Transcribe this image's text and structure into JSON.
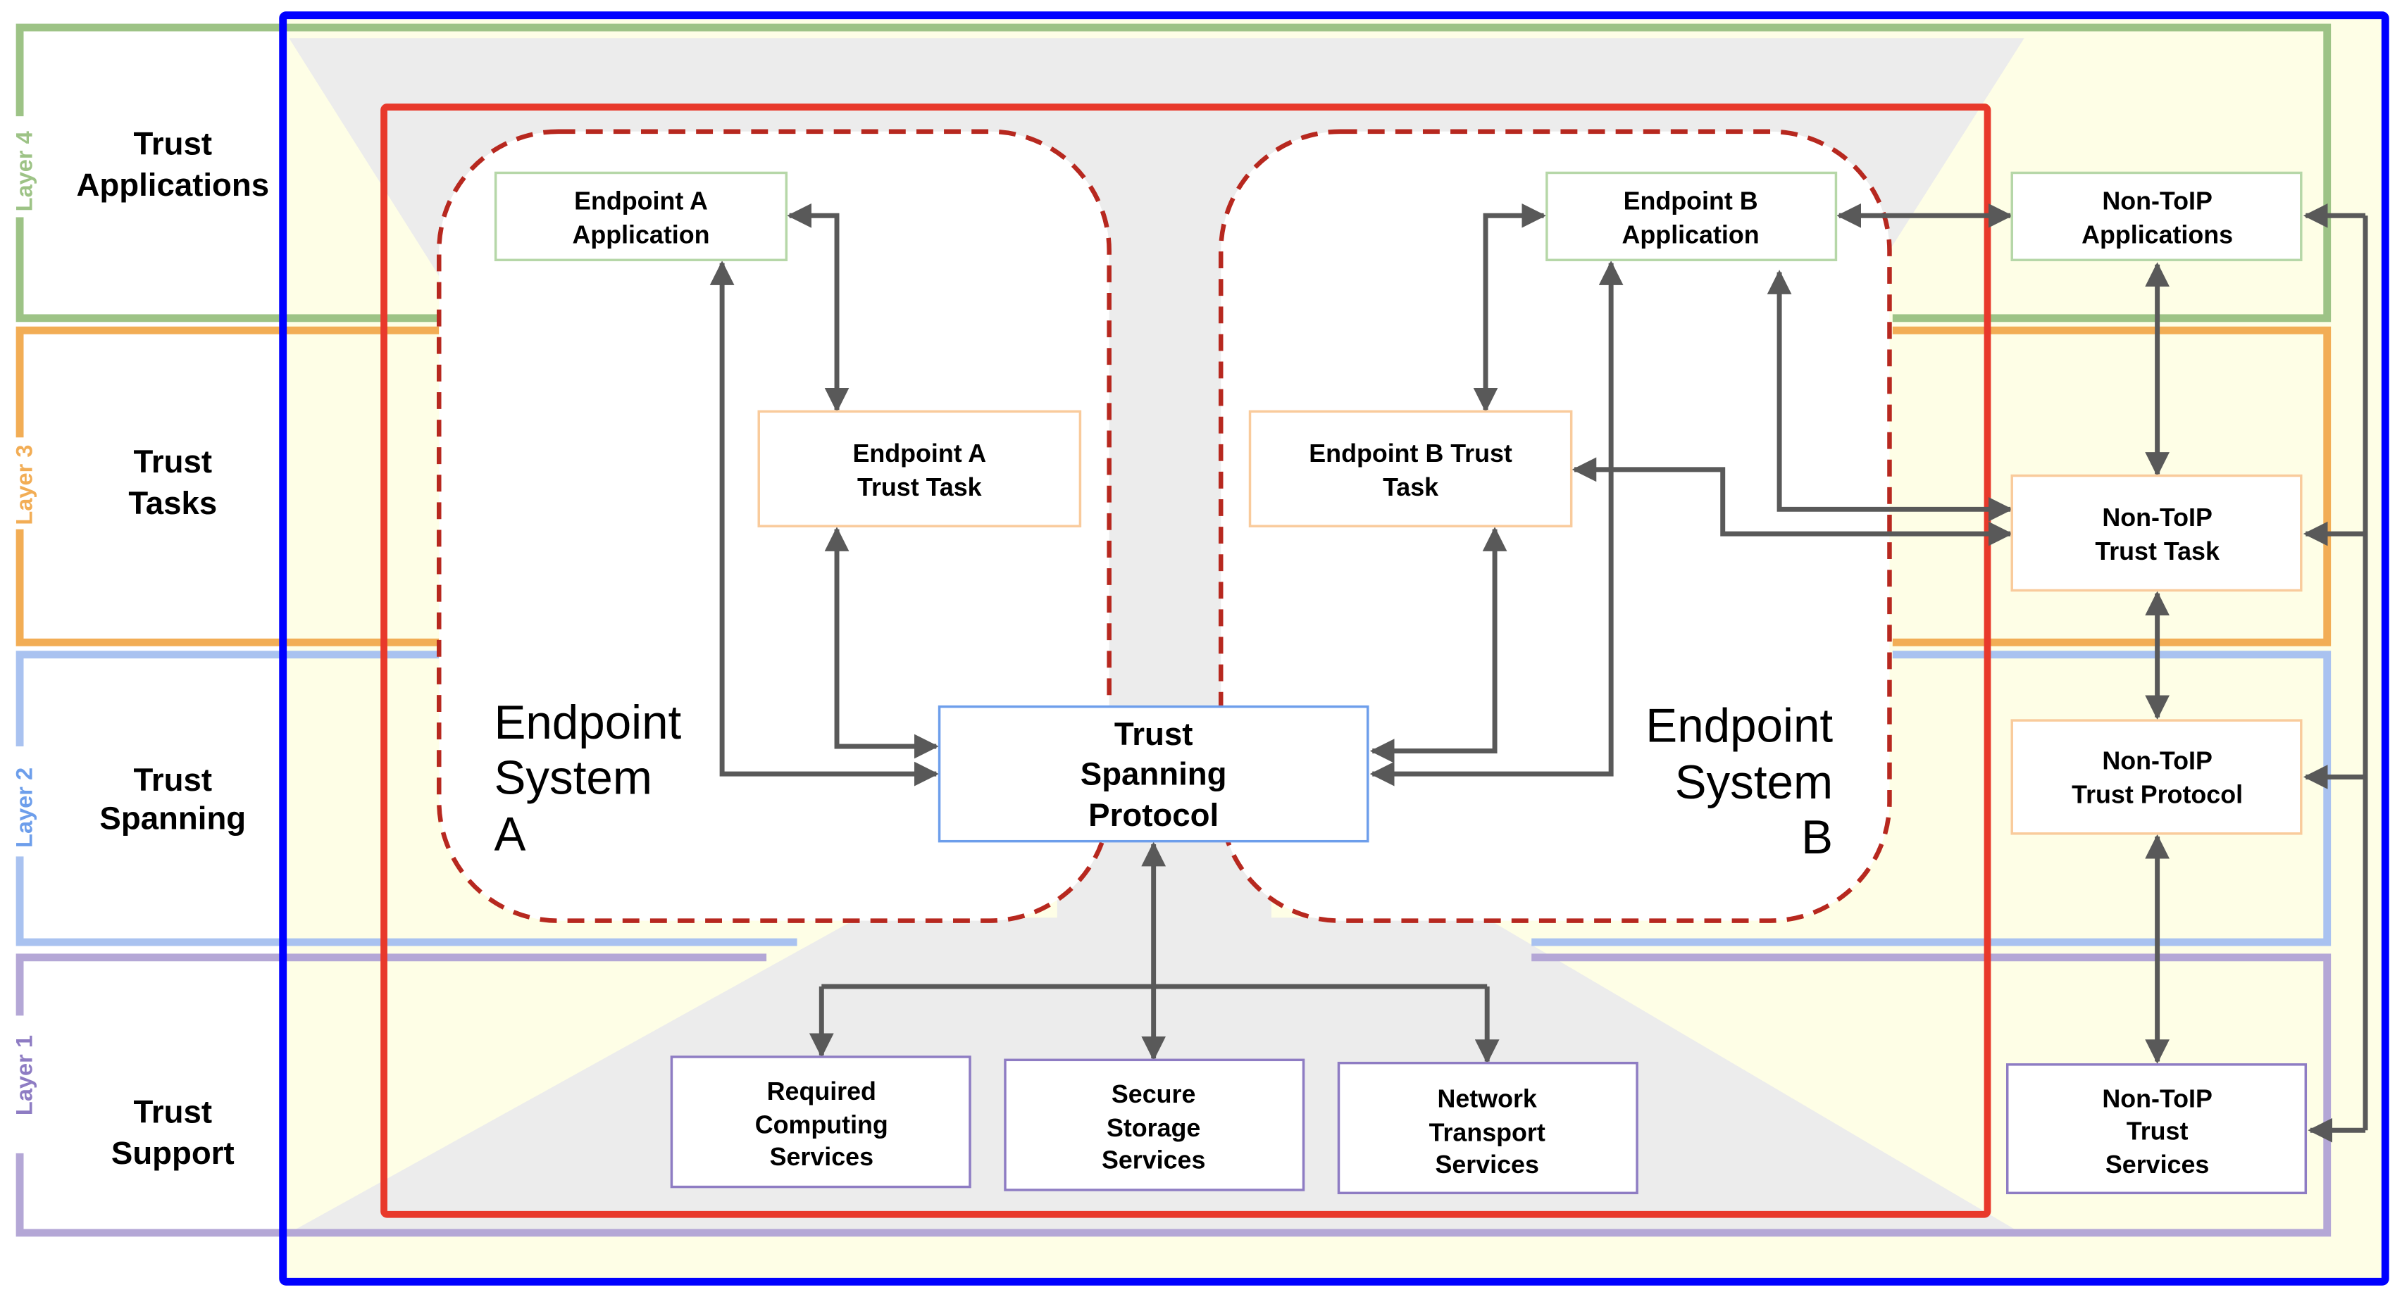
{
  "diagram": {
    "layers": [
      {
        "tag": "Layer 4",
        "title_line1": "Trust",
        "title_line2": "Applications",
        "color": "#9dc386",
        "tag_color": "#9dc386"
      },
      {
        "tag": "Layer 3",
        "title_line1": "Trust",
        "title_line2": "Tasks",
        "color": "#f2ad55",
        "tag_color": "#f2ad55"
      },
      {
        "tag": "Layer 2",
        "title_line1": "Trust",
        "title_line2": "Spanning",
        "color": "#a9c2f0",
        "tag_color": "#6d9eeb"
      },
      {
        "tag": "Layer 1",
        "title_line1": "Trust",
        "title_line2": "Support",
        "color": "#b4a7d6",
        "tag_color": "#8e7cc3"
      }
    ],
    "endpoint_system_a": {
      "line1": "Endpoint",
      "line2": "System",
      "line3": "A"
    },
    "endpoint_system_b": {
      "line1": "Endpoint",
      "line2": "System",
      "line3": "B"
    },
    "boxes": {
      "endpoint_a_application": {
        "line1": "Endpoint A",
        "line2": "Application"
      },
      "endpoint_a_trust_task": {
        "line1": "Endpoint A",
        "line2": "Trust Task"
      },
      "endpoint_b_application": {
        "line1": "Endpoint B",
        "line2": "Application"
      },
      "endpoint_b_trust_task": {
        "line1": "Endpoint B Trust",
        "line2": "Task"
      },
      "trust_spanning_protocol": {
        "line1": "Trust",
        "line2": "Spanning",
        "line3": "Protocol"
      },
      "required_computing_services": {
        "line1": "Required",
        "line2": "Computing",
        "line3": "Services"
      },
      "secure_storage_services": {
        "line1": "Secure",
        "line2": "Storage",
        "line3": "Services"
      },
      "network_transport_services": {
        "line1": "Network",
        "line2": "Transport",
        "line3": "Services"
      },
      "non_toip_applications": {
        "line1": "Non-ToIP",
        "line2": "Applications"
      },
      "non_toip_trust_task": {
        "line1": "Non-ToIP",
        "line2": "Trust Task"
      },
      "non_toip_trust_protocol": {
        "line1": "Non-ToIP",
        "line2": "Trust Protocol"
      },
      "non_toip_trust_services": {
        "line1": "Non-ToIP",
        "line2": "Trust",
        "line3": "Services"
      }
    },
    "colors": {
      "outer_frame": "#0000ff",
      "toip_frame": "#e8392b",
      "endpoint_dash": "#b7281f",
      "connector": "#595959",
      "background_fill": "#fefee6",
      "funnel_fill": "#ececec"
    }
  }
}
